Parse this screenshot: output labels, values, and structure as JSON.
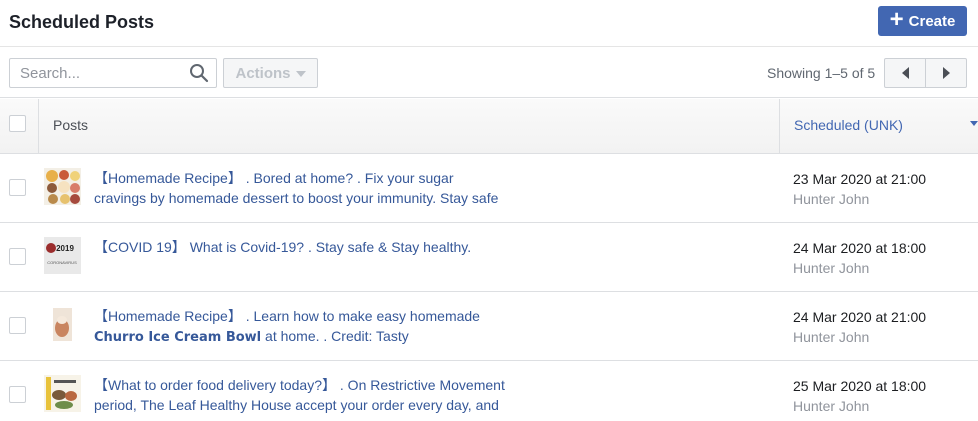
{
  "header": {
    "title": "Scheduled Posts",
    "create_label": "Create"
  },
  "toolbar": {
    "search_placeholder": "Search...",
    "actions_label": "Actions",
    "showing": "Showing 1–5 of 5"
  },
  "table": {
    "col_posts": "Posts",
    "col_scheduled": "Scheduled (UNK)",
    "rows": [
      {
        "line1": "【Homemade Recipe】 . Bored at home? . Fix your sugar",
        "line2_bold": "",
        "line2": "cravings by homemade dessert to boost your immunity. Stay safe",
        "date": "23 Mar 2020 at 21:00",
        "author": "Hunter John"
      },
      {
        "line1": "【COVID 19】 What is Covid-19? . Stay safe & Stay healthy.",
        "line2_bold": "",
        "line2": "",
        "date": "24 Mar 2020 at 18:00",
        "author": "Hunter John",
        "thumb_text_1": "2019",
        "thumb_text_2": "CORONAVIRUS"
      },
      {
        "line1": "【Homemade Recipe】 . Learn how to make easy homemade",
        "line2_bold": "Churro Ice Cream Bowl",
        "line2": " at home. . Credit: Tasty",
        "date": "24 Mar 2020 at 21:00",
        "author": "Hunter John"
      },
      {
        "line1": "【What to order food delivery today?】 . On Restrictive Movement",
        "line2_bold": "",
        "line2": "period, The Leaf Healthy House accept your order every day, and",
        "date": "25 Mar 2020 at 18:00",
        "author": "Hunter John"
      }
    ]
  },
  "colors": {
    "accent": "#4267b2",
    "link": "#365899",
    "muted": "#90949c"
  },
  "icons": {
    "search": "search-icon",
    "sort": "caret-down-icon",
    "prev": "chevron-left-icon",
    "next": "chevron-right-icon",
    "add": "plus-icon"
  }
}
